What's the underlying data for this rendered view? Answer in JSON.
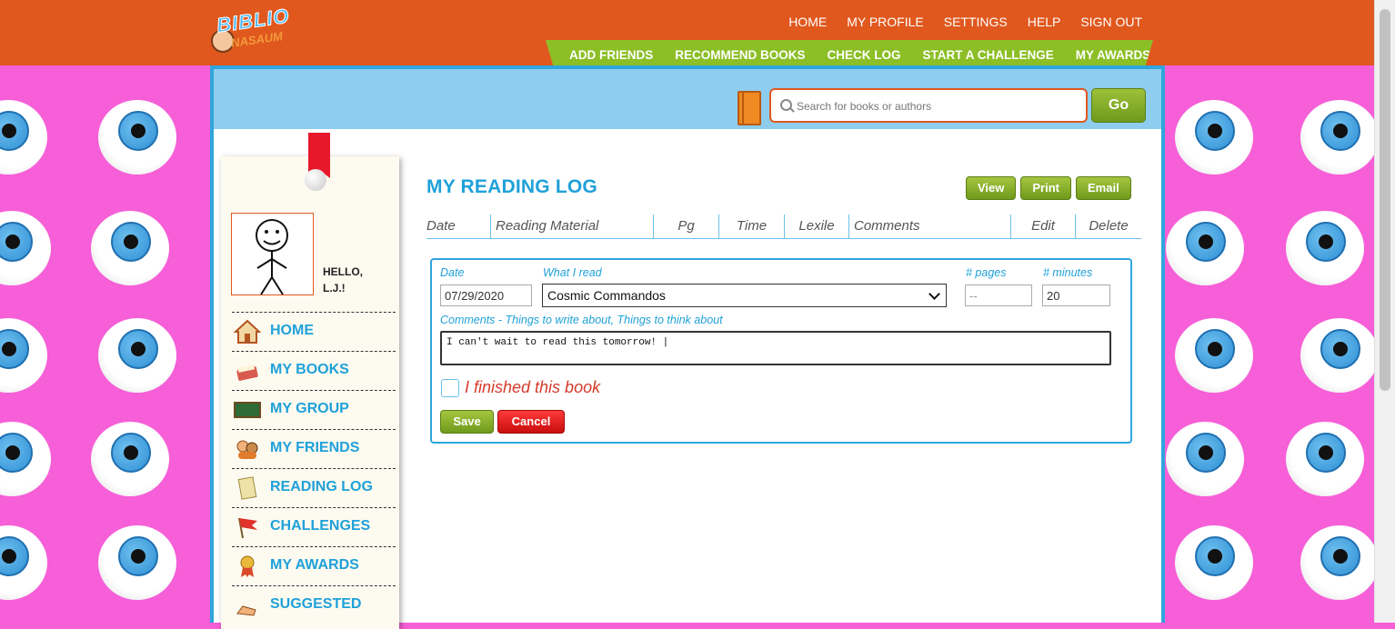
{
  "header": {
    "logo_main": "BIBLIO",
    "logo_sub": "NASAUM",
    "top_nav": [
      "HOME",
      "MY PROFILE",
      "SETTINGS",
      "HELP",
      "SIGN OUT"
    ],
    "action_nav": [
      "ADD FRIENDS",
      "RECOMMEND BOOKS",
      "CHECK LOG",
      "START A CHALLENGE",
      "MY AWARDS"
    ]
  },
  "search": {
    "placeholder": "Search for books or authors",
    "go_label": "Go"
  },
  "sidebar": {
    "hello_line1": "HELLO,",
    "hello_line2": "L.J.!",
    "items": [
      {
        "label": "HOME",
        "icon": "house-icon"
      },
      {
        "label": "MY BOOKS",
        "icon": "books-icon"
      },
      {
        "label": "MY GROUP",
        "icon": "chalkboard-icon"
      },
      {
        "label": "MY FRIENDS",
        "icon": "friends-icon"
      },
      {
        "label": "READING LOG",
        "icon": "scroll-icon"
      },
      {
        "label": "CHALLENGES",
        "icon": "flag-icon"
      },
      {
        "label": "MY AWARDS",
        "icon": "medal-icon"
      },
      {
        "label": "SUGGESTED",
        "icon": "hand-icon"
      }
    ]
  },
  "main": {
    "title": "MY READING LOG",
    "buttons": [
      "View",
      "Print",
      "Email"
    ],
    "columns": [
      "Date",
      "Reading Material",
      "Pg",
      "Time",
      "Lexile",
      "Comments",
      "Edit",
      "Delete"
    ]
  },
  "form": {
    "date_label": "Date",
    "what_label": "What I read",
    "pages_label": "# pages",
    "minutes_label": "# minutes",
    "date_value": "07/29/2020",
    "book_value": "Cosmic Commandos",
    "pages_placeholder": "--",
    "minutes_value": "20",
    "comments_label": "Comments - Things to write about, Things to think about",
    "comments_value": "I can't wait to read this tomorrow! |",
    "finished_label": "I finished this book",
    "save_label": "Save",
    "cancel_label": "Cancel"
  },
  "colors": {
    "header_orange": "#e0581e",
    "nav_green": "#8cbf26",
    "accent_blue": "#1fa1d9",
    "background_pink": "#f65fd7",
    "cancel_red": "#d91818"
  }
}
